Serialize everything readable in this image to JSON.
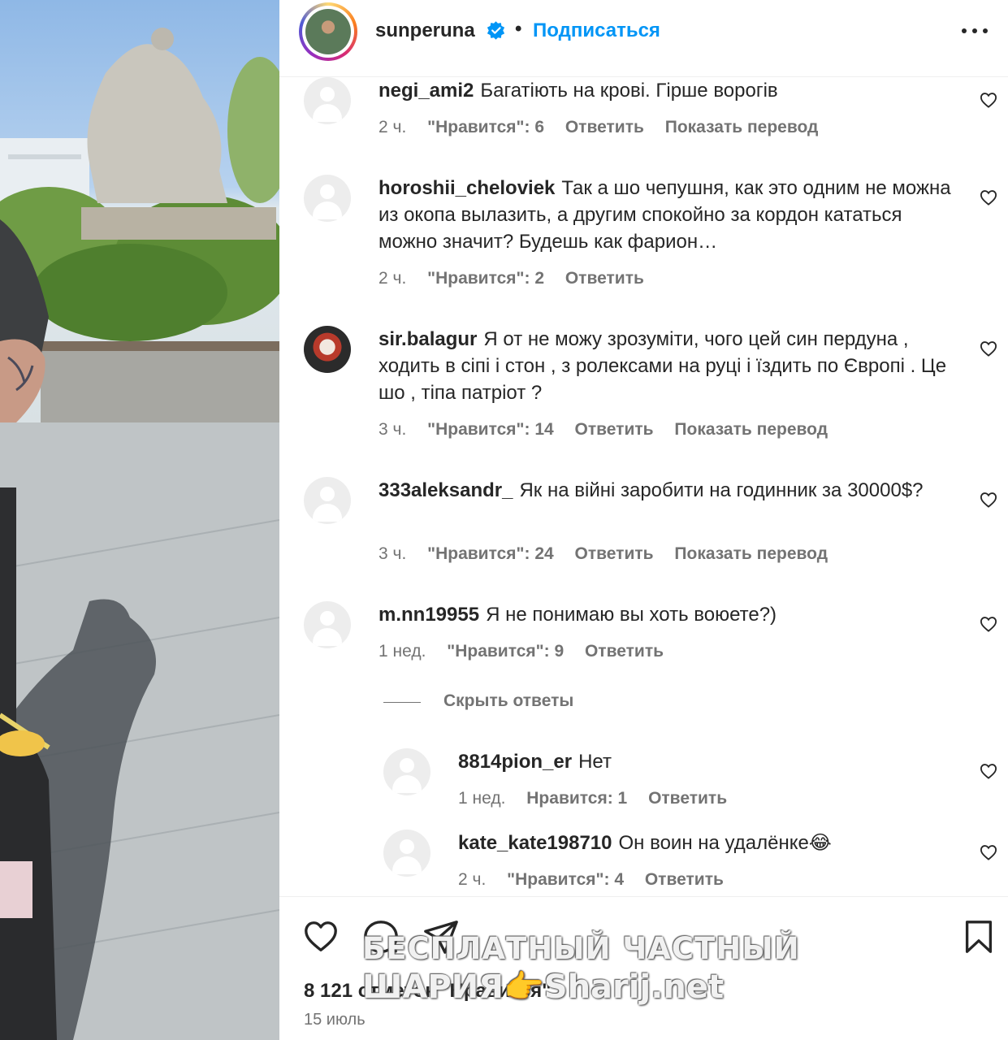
{
  "header": {
    "username": "sunperuna",
    "separator": "•",
    "follow_label": "Подписаться"
  },
  "comments": [
    {
      "username": "negi_ami2",
      "text": "Багатіють на крові. Гірше ворогів",
      "time": "2 ч.",
      "likes": "\"Нравится\": 6",
      "reply": "Ответить",
      "translate": "Показать перевод"
    },
    {
      "username": "horoshii_cheloviek",
      "text": "Так а шо чепушня, как это одним не можна из окопа вылазить, а другим спокойно за кордон кататься можно значит? Будешь как фарион…",
      "time": "2 ч.",
      "likes": "\"Нравится\": 2",
      "reply": "Ответить"
    },
    {
      "username": "sir.balagur",
      "text": "Я от не можу зрозуміти, чого цей син пердуна , ходить в сіпі і стон , з ролексами на руці і їздить по Європі . Це шо , тіпа патріот ?",
      "time": "3 ч.",
      "likes": "\"Нравится\": 14",
      "reply": "Ответить",
      "translate": "Показать перевод"
    },
    {
      "username": "333aleksandr_",
      "text": "Як на війні заробити на годинник за 30000$?",
      "time": "3 ч.",
      "likes": "\"Нравится\": 24",
      "reply": "Ответить",
      "translate": "Показать перевод"
    },
    {
      "username": "m.nn19955",
      "text": "Я не понимаю вы хоть воюете?)",
      "time": "1 нед.",
      "likes": "\"Нравится\": 9",
      "reply": "Ответить"
    }
  ],
  "hide_replies": "Скрыть ответы",
  "replies": [
    {
      "username": "8814pion_er",
      "text": "Нет",
      "time": "1 нед.",
      "likes": "Нравится: 1",
      "reply": "Ответить"
    },
    {
      "username": "kate_kate198710",
      "text": "Он воин на удалёнке😂",
      "time": "2 ч.",
      "likes": "\"Нравится\": 4",
      "reply": "Ответить"
    }
  ],
  "post": {
    "likes": "8 121 отметок \"Нравится\"",
    "date": "15 июль"
  },
  "watermark": {
    "line1": "БЕСПЛАТНЫЙ ЧАСТНЫЙ",
    "line2": "ШАРИЯ👉Sharij.net"
  },
  "icons": {
    "verified": "verified-badge-icon",
    "more": "more-options-icon",
    "like": "heart-icon",
    "comment": "comment-icon",
    "share": "share-icon",
    "save": "bookmark-icon"
  },
  "colors": {
    "accent": "#0095f6",
    "text": "#262626",
    "secondary": "#737373"
  }
}
